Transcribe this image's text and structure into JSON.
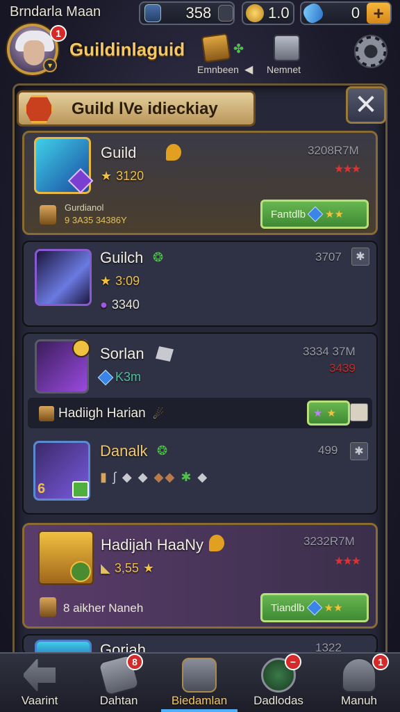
{
  "topbar": {
    "player_name": "Brndarla Maan",
    "resources": [
      {
        "icon": "shield-coin-icon",
        "value": "358"
      },
      {
        "icon": "crown-coin-icon",
        "value": "1.0"
      },
      {
        "icon": "potion-icon",
        "value": "0"
      }
    ],
    "add_label": "+"
  },
  "header": {
    "avatar_badge": "1",
    "guild_title": "Guildinlaguid",
    "icons": [
      {
        "icon": "treasure-chest-icon",
        "label": "Emnbeen"
      },
      {
        "icon": "gift-box-icon",
        "label": "Nemnet"
      }
    ],
    "arrow_label": "◀",
    "settings_icon": "gear-icon"
  },
  "panel": {
    "title": "Guild  lVe  idieckiay",
    "close_label": "✕"
  },
  "cards": [
    {
      "name": "Guild",
      "stat": "3120",
      "right_value": "3208R7M",
      "sub_label": "Gurdianol",
      "sub_value": "9 3A35 34386Y",
      "button_label": "Fantdlb"
    },
    {
      "name": "Guilch",
      "stat": "3:09",
      "stat2": "3340",
      "right_value": "3707"
    },
    {
      "name": "Sorlan",
      "stat": "K3m",
      "right_value": "3334 37M",
      "right_value2": "3439"
    },
    {
      "strip_label": "Hadiigh Harian"
    },
    {
      "name": "Danalk",
      "right_value": "499",
      "level": "6"
    },
    {
      "name": "Hadijah HaaNy",
      "stat": "3,55",
      "right_value": "3232R7M",
      "sub_value": "8 aikher Naneh",
      "button_label": "Tiandlb"
    },
    {
      "name": "Goriah",
      "right_value": "1322"
    }
  ],
  "bottom_nav": [
    {
      "label": "Vaarint",
      "icon": "back-arrow-icon",
      "badge": ""
    },
    {
      "label": "Dahtan",
      "icon": "flag-icon",
      "badge": "8"
    },
    {
      "label": "Biedamlan",
      "icon": "guild-hall-icon",
      "badge": ""
    },
    {
      "label": "Dadlodas",
      "icon": "shield-icon",
      "badge": "−"
    },
    {
      "label": "Manuh",
      "icon": "helmet-icon",
      "badge": "1"
    }
  ],
  "colors": {
    "gold_text": "#f4c869",
    "green_button": "#4f9e3e",
    "badge_red": "#d42a2a"
  }
}
